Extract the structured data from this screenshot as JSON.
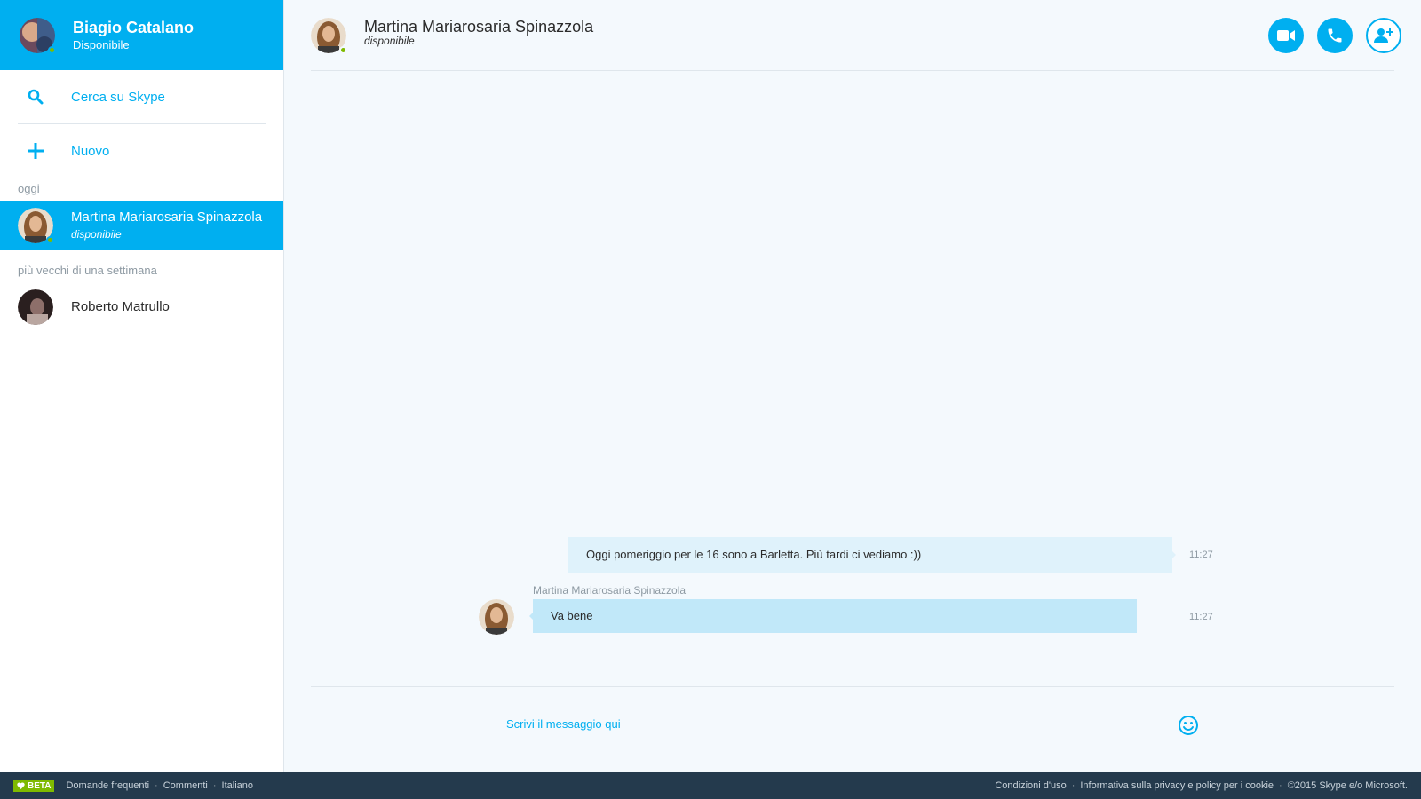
{
  "user": {
    "name": "Biagio Catalano",
    "status": "Disponibile"
  },
  "sidebar": {
    "search_label": "Cerca su Skype",
    "new_label": "Nuovo",
    "section_today": "oggi",
    "section_older": "più vecchi di una settimana",
    "conversations": [
      {
        "name": "Martina Mariarosaria Spinazzola",
        "status": "disponibile",
        "active": true
      },
      {
        "name": "Roberto Matrullo",
        "status": "",
        "active": false
      }
    ]
  },
  "chat": {
    "contact_name": "Martina Mariarosaria Spinazzola",
    "contact_status": "disponibile",
    "messages": [
      {
        "direction": "outgoing",
        "text": "Oggi pomeriggio per le 16 sono a Barletta. Più tardi ci vediamo :))",
        "time": "11:27"
      },
      {
        "direction": "incoming",
        "sender": "Martina Mariarosaria Spinazzola",
        "text": "Va bene",
        "time": "11:27"
      }
    ],
    "composer_placeholder": "Scrivi il messaggio qui"
  },
  "footer": {
    "beta_label": "BETA",
    "left_links": [
      "Domande frequenti",
      "Commenti",
      "Italiano"
    ],
    "right_links": [
      "Condizioni d'uso",
      "Informativa sulla privacy e policy per i cookie",
      "©2015 Skype e/o Microsoft."
    ]
  },
  "colors": {
    "accent": "#00aff0",
    "presence": "#7fba00",
    "footer_bg": "#243a4d",
    "incoming_bubble": "#c1e8f9",
    "outgoing_bubble": "#dff2fb"
  },
  "icons": {
    "search": "search-icon",
    "new": "plus-icon",
    "video": "video-camera-icon",
    "call": "phone-icon",
    "add_user": "add-user-icon",
    "emoji": "smiley-icon",
    "beta": "heart-icon"
  }
}
